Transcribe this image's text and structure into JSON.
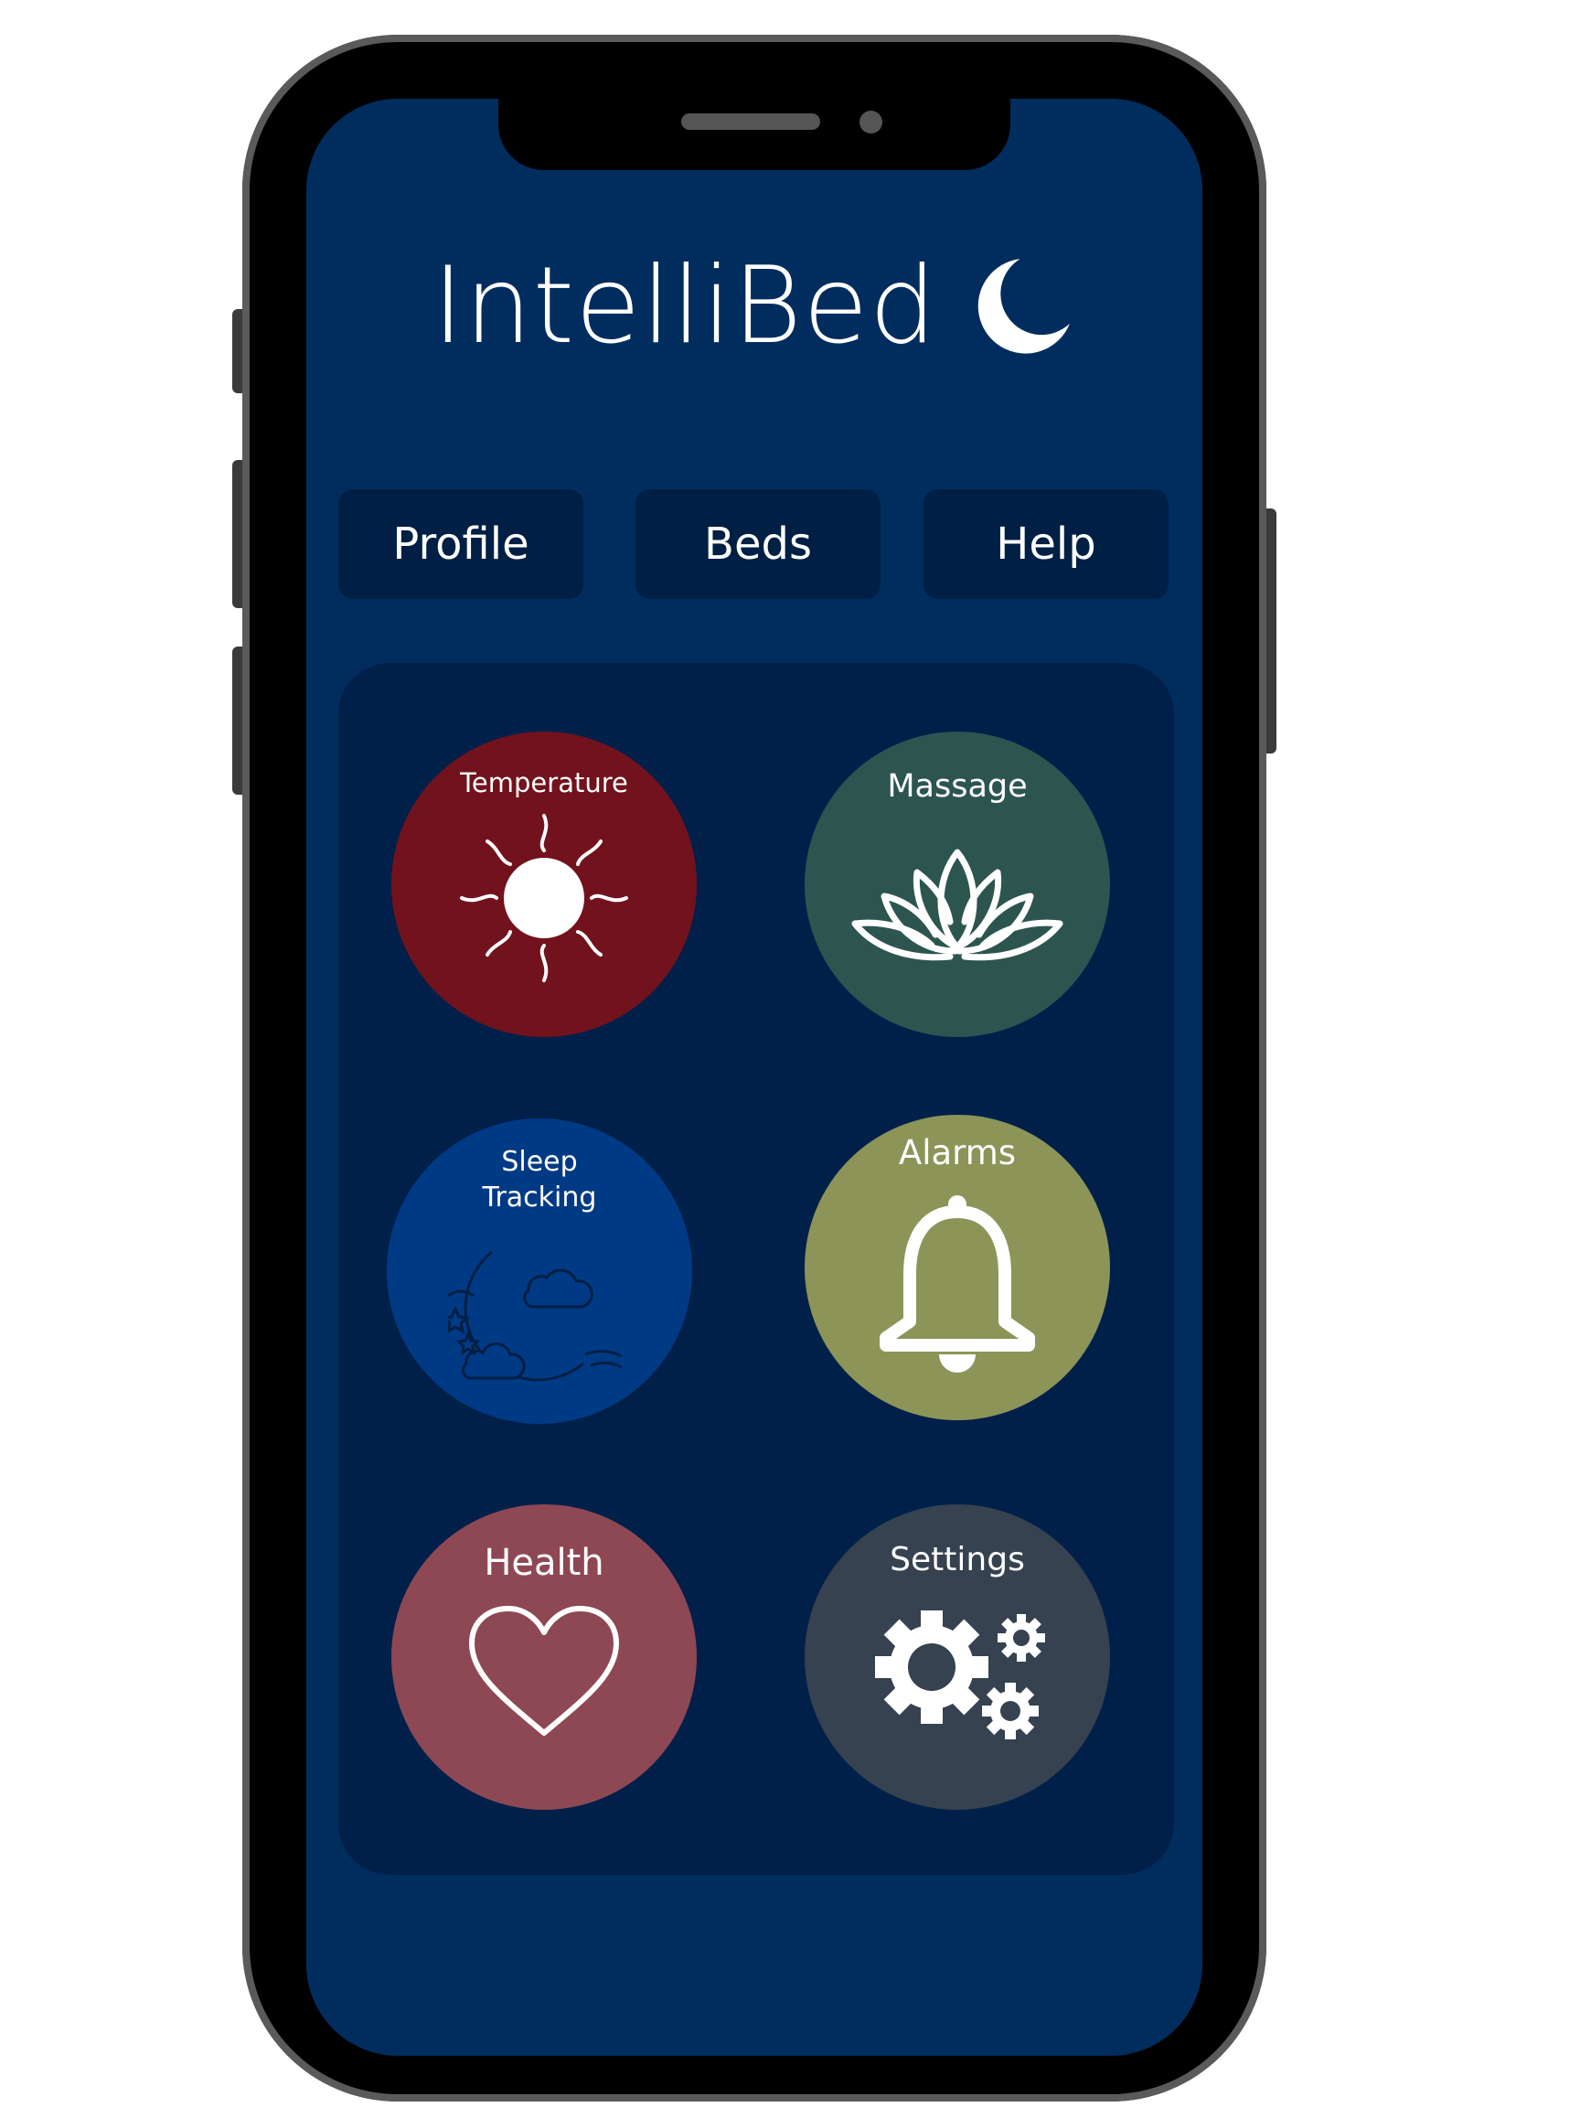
{
  "app": {
    "title": "IntelliBed"
  },
  "nav": {
    "items": [
      "Profile",
      "Beds",
      "Help"
    ]
  },
  "tiles": {
    "temperature": {
      "label": "Temperature",
      "color": "#72121c"
    },
    "massage": {
      "label": "Massage",
      "color": "#2d5550"
    },
    "sleep_tracking": {
      "label_line1": "Sleep",
      "label_line2": "Tracking",
      "color": "#003a85"
    },
    "alarms": {
      "label": "Alarms",
      "color": "#8d9458"
    },
    "health": {
      "label": "Health",
      "color": "#8d4854"
    },
    "settings": {
      "label": "Settings",
      "color": "#36424f"
    }
  },
  "colors": {
    "screen_bg": "#012d5e",
    "nav_bg": "#001f44",
    "panel_bg": "#00204a"
  }
}
